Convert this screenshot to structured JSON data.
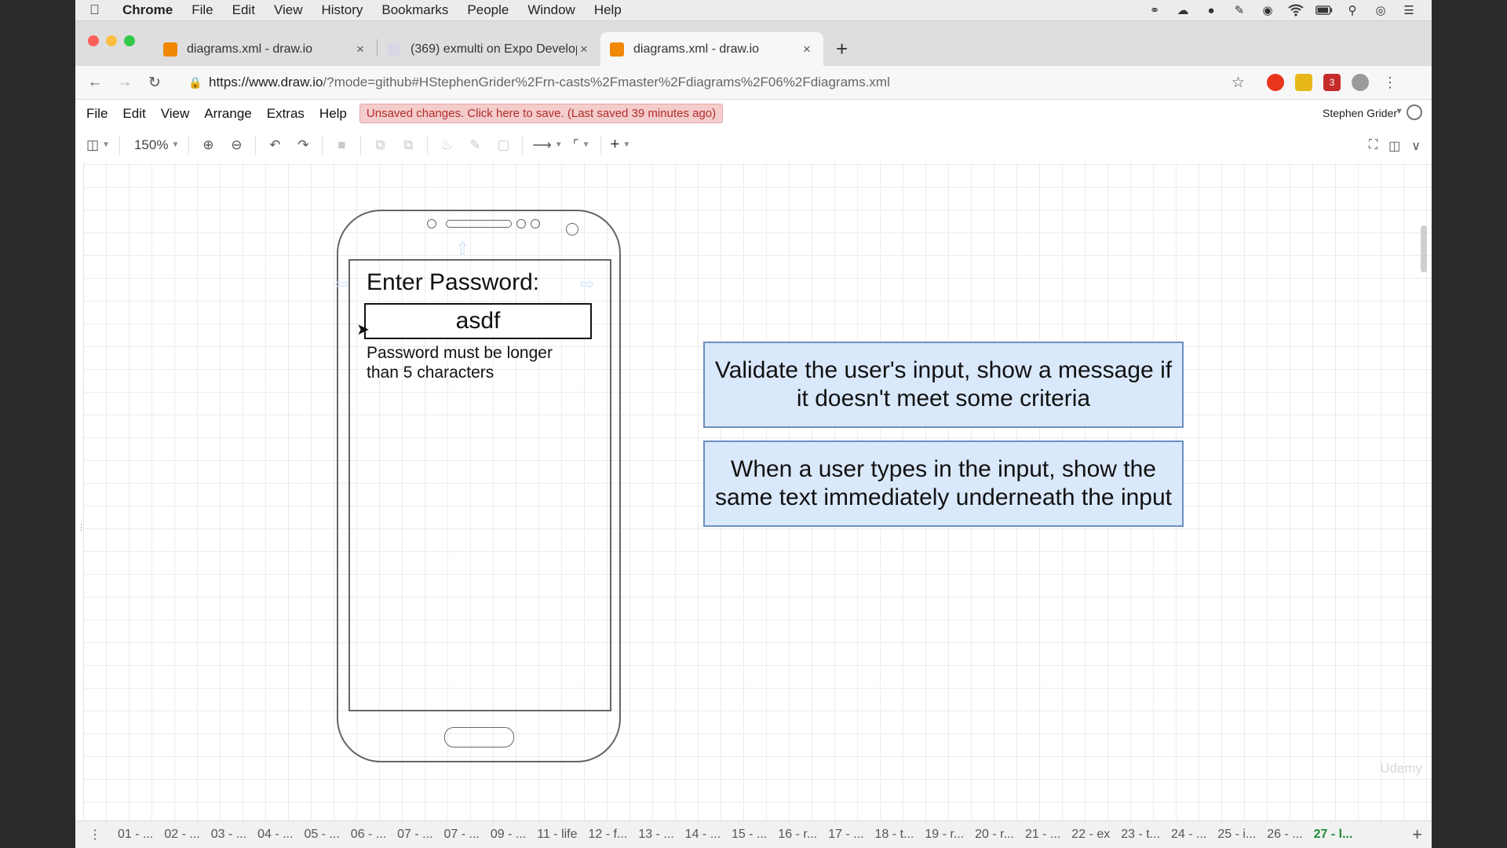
{
  "mac_menu": {
    "app": "Chrome",
    "items": [
      "File",
      "Edit",
      "View",
      "History",
      "Bookmarks",
      "People",
      "Window",
      "Help"
    ],
    "status_icons": [
      "glasses-icon",
      "cloud-icon",
      "elephant-icon",
      "evernote-icon",
      "dark-circle-icon",
      "wifi-icon",
      "battery-icon",
      "search-icon",
      "siri-icon",
      "list-icon"
    ]
  },
  "browser": {
    "tabs": [
      {
        "title": "diagrams.xml - draw.io",
        "active": false
      },
      {
        "title": "(369) exmulti on Expo Develop",
        "active": false
      },
      {
        "title": "diagrams.xml - draw.io",
        "active": true
      }
    ],
    "url_host": "https://www.draw.io",
    "url_path": "/?mode=github#HStephenGrider%2Frn-casts%2Fmaster%2Fdiagrams%2F06%2Fdiagrams.xml",
    "ext_badge": "3"
  },
  "drawio": {
    "menu": [
      "File",
      "Edit",
      "View",
      "Arrange",
      "Extras",
      "Help"
    ],
    "unsaved_notice": "Unsaved changes. Click here to save. (Last saved 39 minutes ago)",
    "user": "Stephen Grider",
    "zoom": "150%"
  },
  "diagram": {
    "enter_label": "Enter Password:",
    "input_value": "asdf",
    "error_message": "Password must be longer than 5 characters",
    "note1": "Validate the user's input, show a message if it doesn't meet some criteria",
    "note2": "When a user types in the input, show the same text immediately underneath the input"
  },
  "watermark": "Udemy",
  "pages": [
    "01 - ...",
    "02 - ...",
    "03 - ...",
    "04 - ...",
    "05 - ...",
    "06 - ...",
    "07 - ...",
    "07 - ...",
    "09 - ...",
    "11 - life",
    "12 - f...",
    "13 - ...",
    "14 - ...",
    "15 - ...",
    "16 - r...",
    "17 - ...",
    "18 - t...",
    "19 - r...",
    "20 - r...",
    "21 - ...",
    "22 - ex",
    "23 - t...",
    "24 - ...",
    "25 - i...",
    "26 - ...",
    "27 - l..."
  ],
  "active_page": "27 - l...",
  "colors": {
    "unsaved_bg": "#f4cccc",
    "note_fill": "#dae8fc",
    "note_stroke": "#6c8ebf",
    "active_page": "#1f8a3a"
  }
}
